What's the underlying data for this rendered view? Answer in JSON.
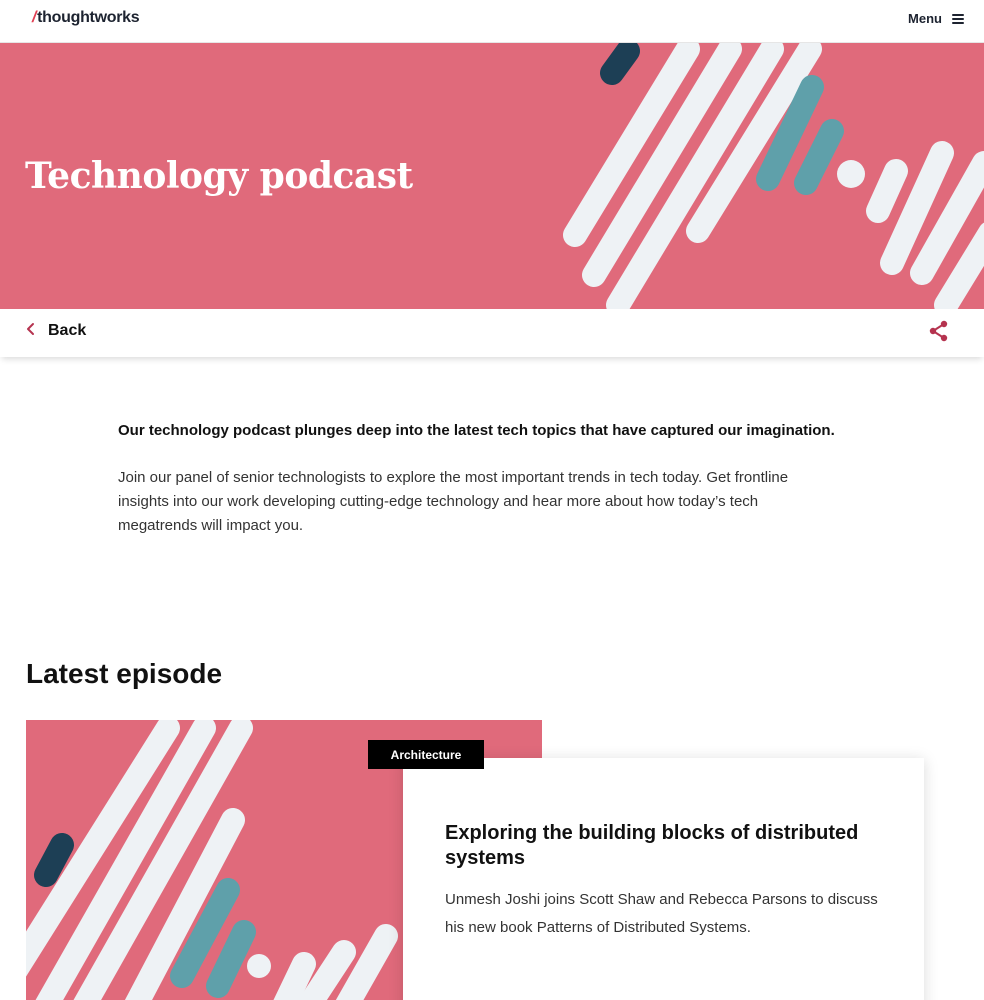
{
  "header": {
    "logo_slash": "/",
    "logo_text": "thoughtworks",
    "menu_label": "Menu"
  },
  "hero": {
    "title": "Technology podcast"
  },
  "nav": {
    "back_label": "Back"
  },
  "intro": {
    "lead": "Our technology podcast plunges deep into the latest tech topics that have captured our imagination.",
    "body": "Join our panel of senior technologists to explore the most important trends in tech today. Get frontline insights into our work developing cutting-edge technology and hear more about how today’s tech megatrends will impact you."
  },
  "latest": {
    "heading": "Latest episode",
    "tag": "Architecture",
    "title": "Exploring the building blocks of distributed systems",
    "description": "Unmesh Joshi joins Scott Shaw and Rebecca Parsons to discuss his new book Patterns of Distributed Systems."
  },
  "colors": {
    "brand_pink": "#e06a7b",
    "accent_teal": "#5fa0aa",
    "accent_navy": "#1d3f55",
    "stripe_white": "#eef2f5",
    "accent_red": "#b5334f"
  }
}
